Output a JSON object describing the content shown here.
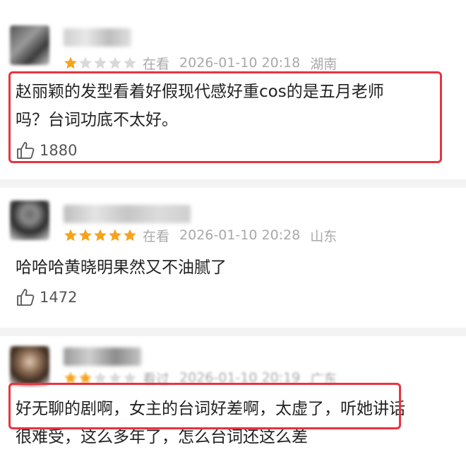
{
  "reviews": [
    {
      "username": "",
      "watch_status": "在看",
      "date": "2026-01-10 20:18",
      "location": "湖南",
      "stars": 1,
      "content_line1": "赵丽颖的发型看着好假现代感好重cos的是五月老师",
      "content_line2": "吗？台词功底不太好。",
      "likes": "1880"
    },
    {
      "username": "",
      "watch_status": "在看",
      "date": "2026-01-10 20:28",
      "location": "山东",
      "stars": 5,
      "content_line1": "哈哈哈黄晓明果然又不油腻了",
      "likes": "1472"
    },
    {
      "username": "",
      "watch_status": "看过",
      "date": "2026-01-10 20:19",
      "location": "广东",
      "stars": 2,
      "content_line1": "好无聊的剧啊，女主的台词好差啊，太虚了，听她讲话",
      "content_line2": "很难受，这么多年了，怎么台词还这么差"
    }
  ],
  "colors": {
    "star_filled": "#f7a21b",
    "star_empty": "#d9d9d9",
    "highlight_border": "#e8333f",
    "meta_text": "#a9a9a9"
  }
}
